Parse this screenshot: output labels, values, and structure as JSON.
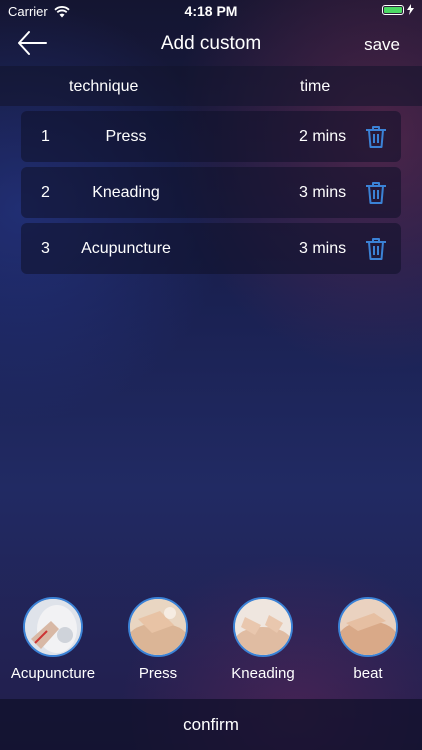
{
  "status_bar": {
    "carrier": "Carrier",
    "time": "4:18 PM",
    "wifi_icon": "wifi-icon",
    "battery_icon": "battery-icon",
    "charging_icon": "bolt-icon"
  },
  "nav": {
    "back_icon": "arrow-left-icon",
    "title": "Add custom",
    "save_label": "save"
  },
  "table": {
    "headers": {
      "technique": "technique",
      "time": "time"
    },
    "rows": [
      {
        "index": "1",
        "technique": "Press",
        "time": "2 mins"
      },
      {
        "index": "2",
        "technique": "Kneading",
        "time": "3 mins"
      },
      {
        "index": "3",
        "technique": "Acupuncture",
        "time": "3 mins"
      }
    ],
    "delete_icon": "trash-icon"
  },
  "technique_picker": [
    {
      "label": "Acupuncture"
    },
    {
      "label": "Press"
    },
    {
      "label": "Kneading"
    },
    {
      "label": "beat"
    }
  ],
  "confirm_label": "confirm",
  "colors": {
    "accent_blue": "#3b82d6",
    "battery_green": "#4cd964",
    "background_dark": "#141531"
  }
}
